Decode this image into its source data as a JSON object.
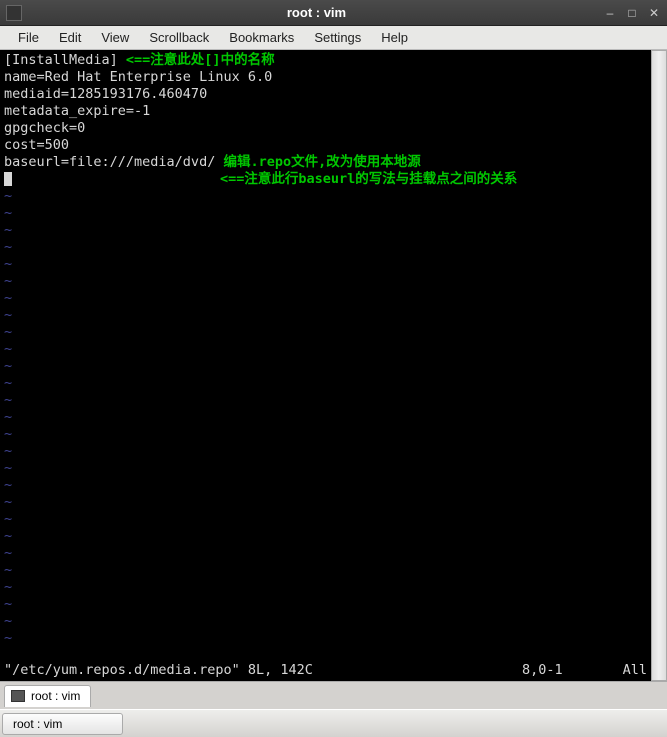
{
  "titlebar": {
    "title": "root : vim"
  },
  "menubar": {
    "items": [
      "File",
      "Edit",
      "View",
      "Scrollback",
      "Bookmarks",
      "Settings",
      "Help"
    ]
  },
  "content": {
    "line1_text": "[InstallMedia]",
    "line1_annot": " <==注意此处[]中的名称",
    "line2": "name=Red Hat Enterprise Linux 6.0",
    "line3": "mediaid=1285193176.460470",
    "line4": "metadata_expire=-1",
    "line5": "gpgcheck=0",
    "line6": "cost=500",
    "line7_text": "baseurl=file:///media/dvd/",
    "line7_annot": " 编辑.repo文件,改为使用本地源",
    "line8_annot": "<==注意此行baseurl的写法与挂载点之间的关系",
    "tilde": "~"
  },
  "status": {
    "file": "\"/etc/yum.repos.d/media.repo\" 8L, 142C",
    "pos": "8,0-1",
    "pct": "All"
  },
  "tabbar": {
    "tab1": "root : vim"
  },
  "taskbar": {
    "item1": "root : vim"
  }
}
